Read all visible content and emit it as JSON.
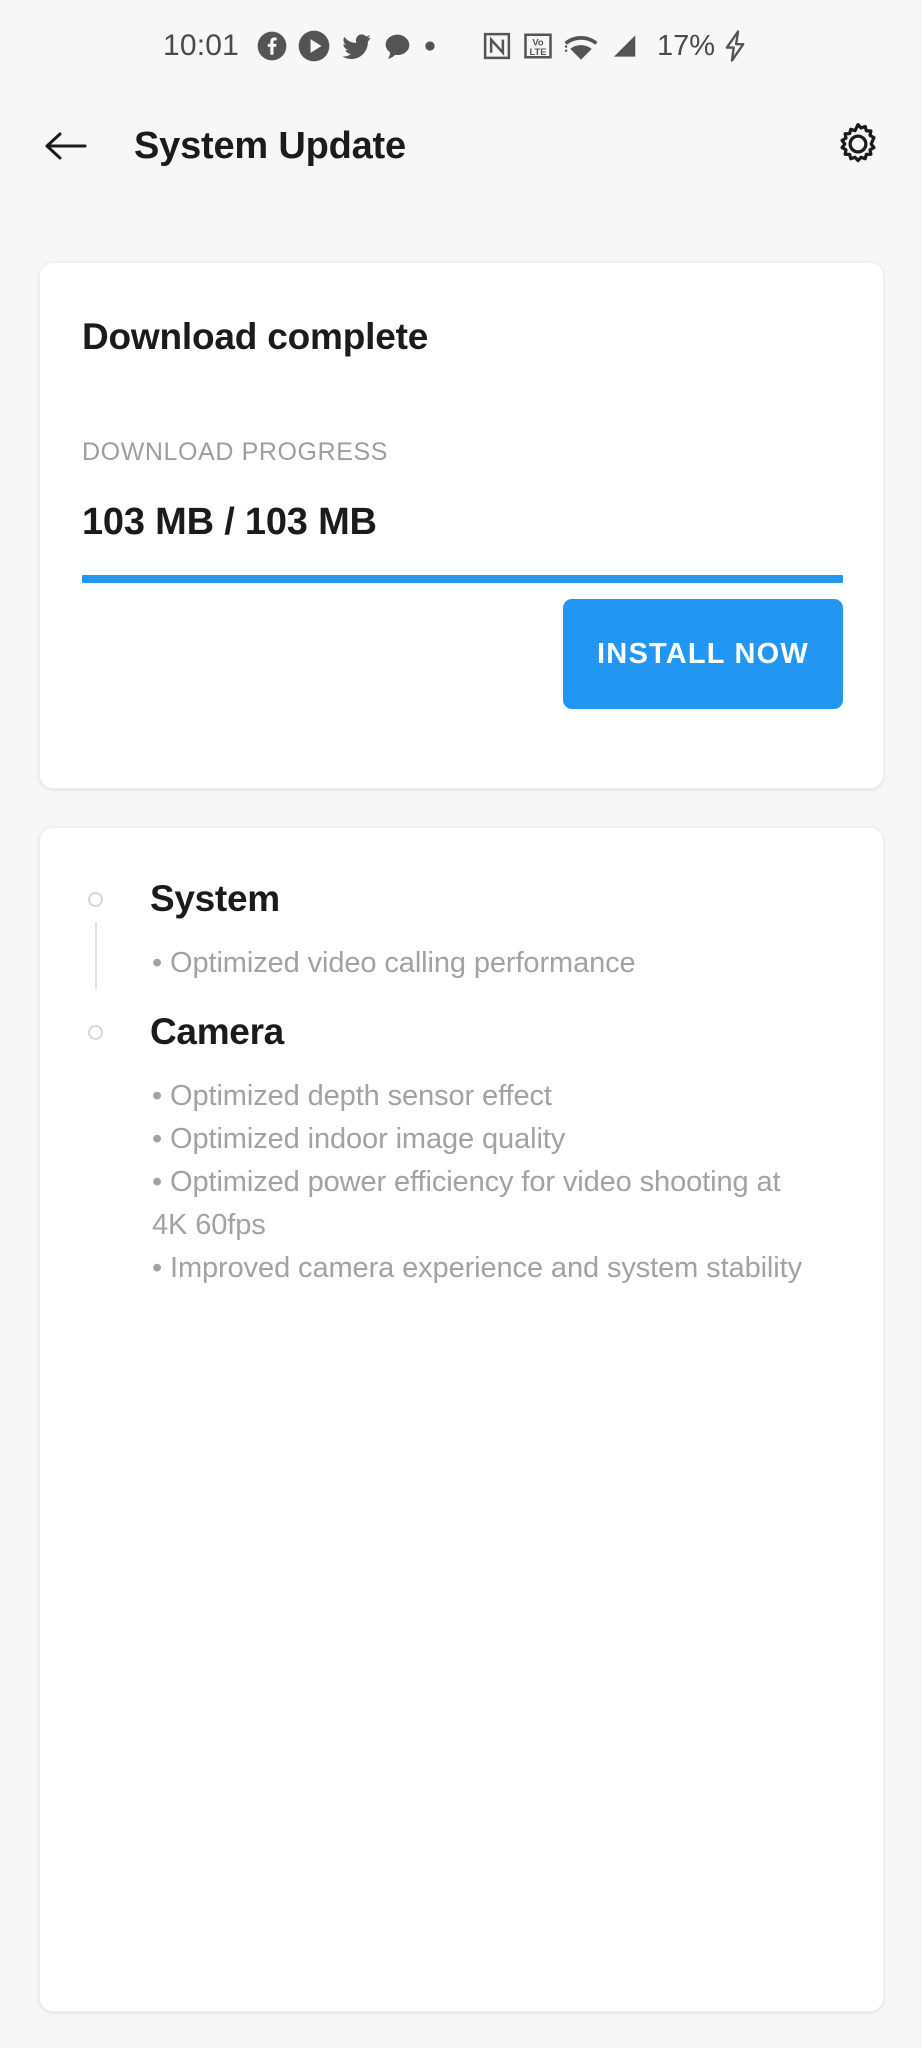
{
  "status_bar": {
    "time": "10:01",
    "battery": "17%",
    "left_icons": [
      {
        "name": "facebook-icon"
      },
      {
        "name": "play-circle-icon"
      },
      {
        "name": "twitter-icon"
      },
      {
        "name": "chat-bubble-icon"
      },
      {
        "name": "dot-icon"
      }
    ],
    "right_icons": [
      {
        "name": "nfc-icon",
        "label": "N"
      },
      {
        "name": "volte-icon",
        "label_top": "Vo",
        "label_bottom": "LTE"
      },
      {
        "name": "wifi-icon"
      },
      {
        "name": "signal-icon"
      },
      {
        "name": "charging-bolt-icon"
      }
    ]
  },
  "app_bar": {
    "back_label": "back",
    "title": "System Update",
    "settings_label": "settings"
  },
  "download_card": {
    "title": "Download complete",
    "progress_label": "DOWNLOAD PROGRESS",
    "size_text": "103 MB / 103 MB",
    "progress_percent": 100,
    "progress_color": "#2196f3",
    "install_button": "INSTALL NOW"
  },
  "changelog": {
    "groups": [
      {
        "heading": "System",
        "items": [
          "• Optimized video calling performance"
        ]
      },
      {
        "heading": "Camera",
        "items": [
          "• Optimized depth sensor effect",
          "• Optimized indoor image quality",
          "• Optimized power efficiency for video shooting at 4K 60fps",
          "• Improved camera experience and system stability"
        ]
      }
    ]
  }
}
